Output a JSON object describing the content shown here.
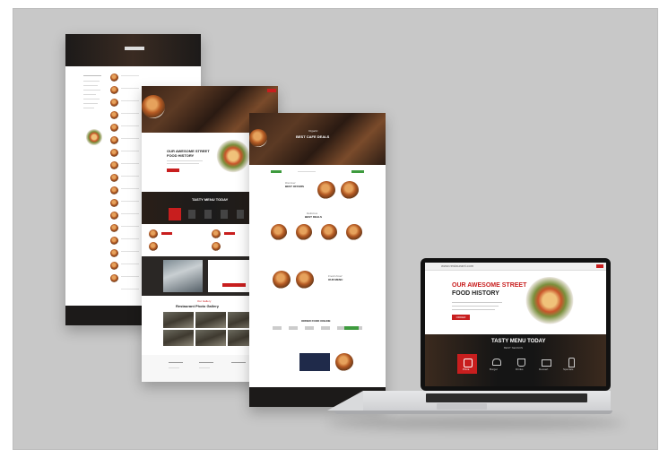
{
  "colors": {
    "frame_bg": "#c8c8c8",
    "brand_red": "#c81e1e",
    "dark_bar": "#1c1a19",
    "accent_green": "#3e9b3e"
  },
  "page2": {
    "hero_heading_line1": "OUR AWESOME STREET",
    "hero_heading_line2": "FOOD HISTORY",
    "menu_heading": "TASTY MENU TODAY",
    "gallery_kicker": "Our Gallery",
    "gallery_title": "Restaurant Photo Gallery"
  },
  "page3": {
    "hero_kicker": "Organic",
    "hero_title": "BEST CAFE DEALS",
    "section1_kicker": "Discover",
    "section1_title": "BEST OFFERS",
    "section2_kicker": "Delicious",
    "section2_title": "BEST DEALS",
    "section3_kicker": "Fresh Food",
    "section3_title": "OUR MENU",
    "section4_title": "ORDER FOOD ONLINE"
  },
  "laptop": {
    "hero_line1": "OUR AWESOME STREET",
    "hero_line2": "FOOD HISTORY",
    "button_label": "ORDER",
    "menu_title": "TASTY MENU TODAY",
    "menu_subtitle": "BEST SEASON",
    "tabs": [
      "Pizza",
      "Burger",
      "Drinks",
      "Dessert",
      "Specials"
    ],
    "address_bar": "www.restaurant.com"
  },
  "icons": [
    "pizza-icon",
    "burger-icon",
    "cup-icon",
    "cake-icon",
    "bottle-icon"
  ]
}
